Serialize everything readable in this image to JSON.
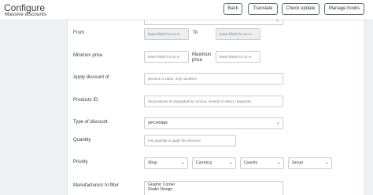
{
  "header": {
    "title": "Configure",
    "subtitle": "Massive discounts",
    "buttons": {
      "back": "Back",
      "translate": "Translate",
      "check_update": "Check update",
      "manage_hooks": "Manage hooks"
    }
  },
  "form": {
    "from_label": "From",
    "from_placeholder": "leave blank for no m",
    "to_label": "To",
    "to_placeholder": "leave blank for no m",
    "min_price_label": "Minimun price",
    "min_price_placeholder": "leave blank for no m",
    "max_price_label": "Maximun price",
    "max_price_placeholder": "leave blank for no m",
    "apply_discount_label": "Apply discount of",
    "apply_discount_placeholder": "percent or value, only numbers",
    "products_id_label": "Products ID",
    "products_id_placeholder": "Set products ID separated by comma, instead of select categories",
    "type_label": "Type of discount",
    "type_value": "percentage",
    "quantity_label": "Quantity",
    "quantity_placeholder": "min quantity to apply the discount",
    "priority_label": "Priority",
    "priority_values": [
      "Shop",
      "Currency",
      "Country",
      "Group"
    ],
    "manufacturers_label": "Manufacturers to filter",
    "manufacturers": [
      "Graphic Corner",
      "Studio Design"
    ]
  },
  "icons": {
    "chevron": "chevron-down-icon"
  }
}
